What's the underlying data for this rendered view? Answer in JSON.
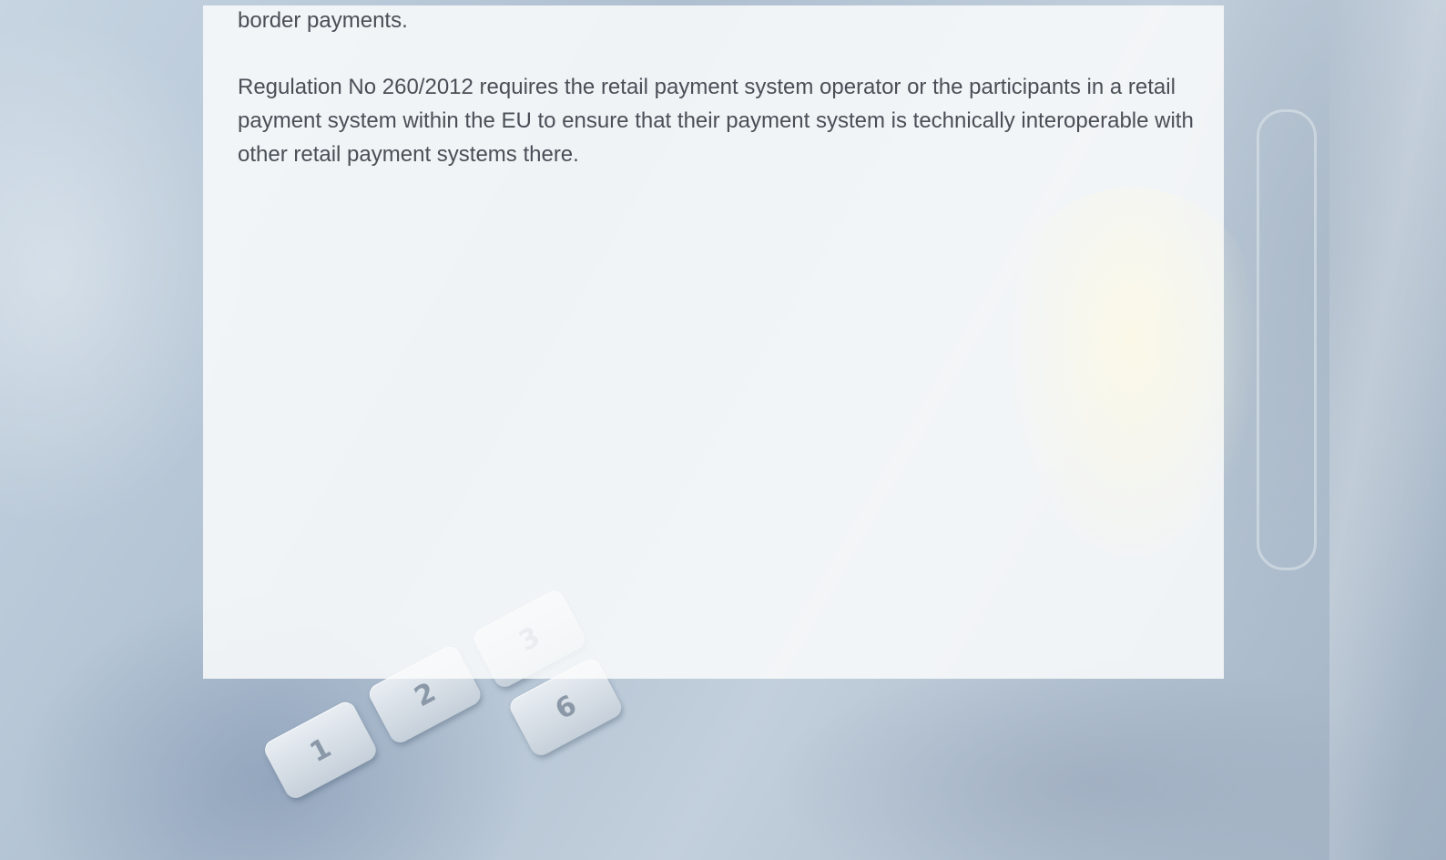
{
  "content": {
    "paragraph_1": "border payments.",
    "paragraph_2": "Regulation No 260/2012 requires the retail payment system operator or the participants in a retail payment system within the EU to ensure that their payment system is technically interoperable with other retail payment systems there."
  },
  "background": {
    "keypad_keys": [
      "1",
      "2",
      "3",
      "6"
    ]
  },
  "colors": {
    "text": "#4a4f57",
    "panel": "#fafbfc"
  }
}
